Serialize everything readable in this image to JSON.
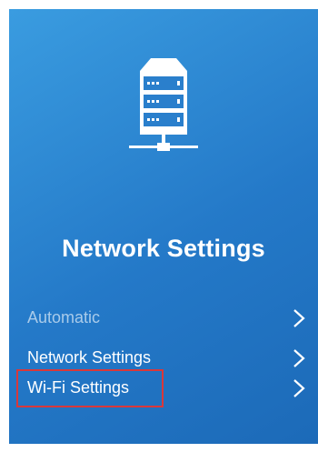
{
  "panel": {
    "title": "Network Settings",
    "background_start": "#3a9ce0",
    "background_end": "#1c6ab8",
    "icon": "server-network-icon"
  },
  "menu": {
    "items": [
      {
        "label": "Automatic",
        "state": "disabled",
        "icon": "chevron-right-icon"
      },
      {
        "label": "Network Settings",
        "state": "enabled",
        "icon": "chevron-right-icon"
      },
      {
        "label": "Wi-Fi Settings",
        "state": "enabled",
        "highlighted": true,
        "icon": "chevron-right-icon"
      }
    ]
  },
  "highlight_color": "#d9383a"
}
